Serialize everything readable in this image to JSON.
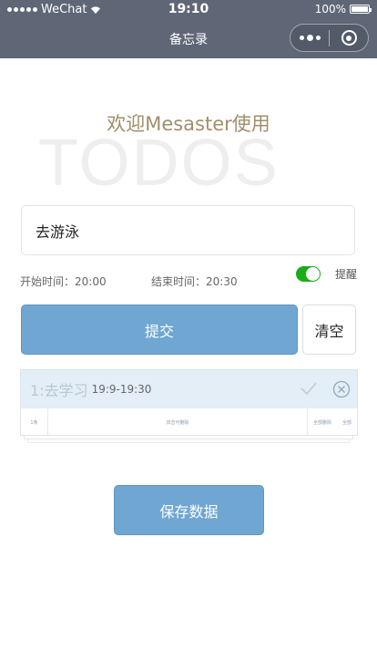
{
  "status_bar": {
    "carrier": "WeChat",
    "time": "19:10",
    "battery": "100%"
  },
  "nav": {
    "title": "备忘录"
  },
  "welcome": {
    "text": "欢迎Mesaster使用",
    "watermark": "TODOS"
  },
  "form": {
    "input_value": "去游泳",
    "start_time": "开始时间：20:00",
    "end_time": "结束时间：20:30",
    "remind_label": "提醒",
    "remind_on": true,
    "submit_label": "提交",
    "clear_label": "清空"
  },
  "todos": [
    {
      "text": "1:去学习",
      "time": "19:9-19:30",
      "footer": [
        "1条",
        "双击可删除",
        "全部删除",
        "全部"
      ]
    }
  ],
  "save_label": "保存数据",
  "colors": {
    "nav_bg": "#5f6777",
    "primary": "#6fa7d2",
    "switch_on": "#1aad19",
    "welcome_text": "#a08f6b"
  }
}
